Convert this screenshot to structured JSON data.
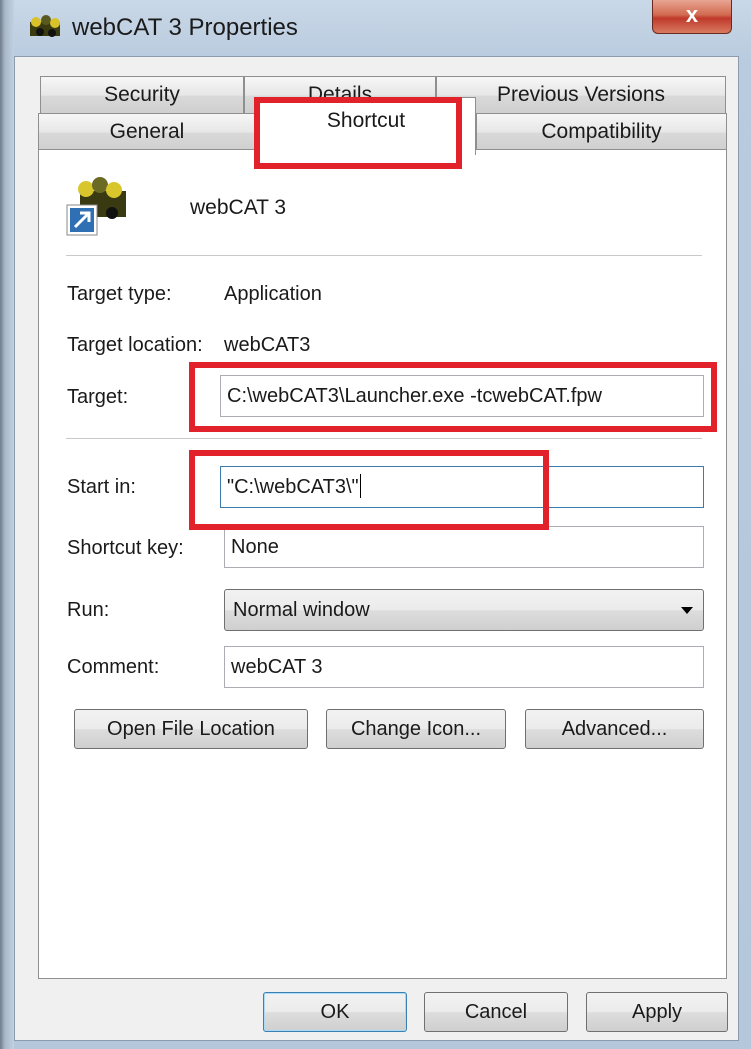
{
  "window": {
    "title": "webCAT 3 Properties",
    "close_label": "x"
  },
  "tabs": {
    "row_back": [
      "Security",
      "Details",
      "Previous Versions"
    ],
    "row_front": [
      "General",
      "Shortcut",
      "Compatibility"
    ],
    "active": "Shortcut"
  },
  "header": {
    "name": "webCAT 3"
  },
  "fields": {
    "target_type_label": "Target type:",
    "target_type_value": "Application",
    "target_location_label": "Target location:",
    "target_location_value": "webCAT3",
    "target_label": "Target:",
    "target_value": "C:\\webCAT3\\Launcher.exe -tcwebCAT.fpw",
    "start_in_label": "Start in:",
    "start_in_value": "\"C:\\webCAT3\\\"",
    "shortcut_key_label": "Shortcut key:",
    "shortcut_key_value": "None",
    "run_label": "Run:",
    "run_value": "Normal window",
    "comment_label": "Comment:",
    "comment_value": "webCAT 3"
  },
  "buttons": {
    "open_file_location": "Open File Location",
    "change_icon": "Change Icon...",
    "advanced": "Advanced...",
    "ok": "OK",
    "cancel": "Cancel",
    "apply": "Apply"
  },
  "colors": {
    "highlight": "#e1222b",
    "accent": "#3c7fb1"
  }
}
